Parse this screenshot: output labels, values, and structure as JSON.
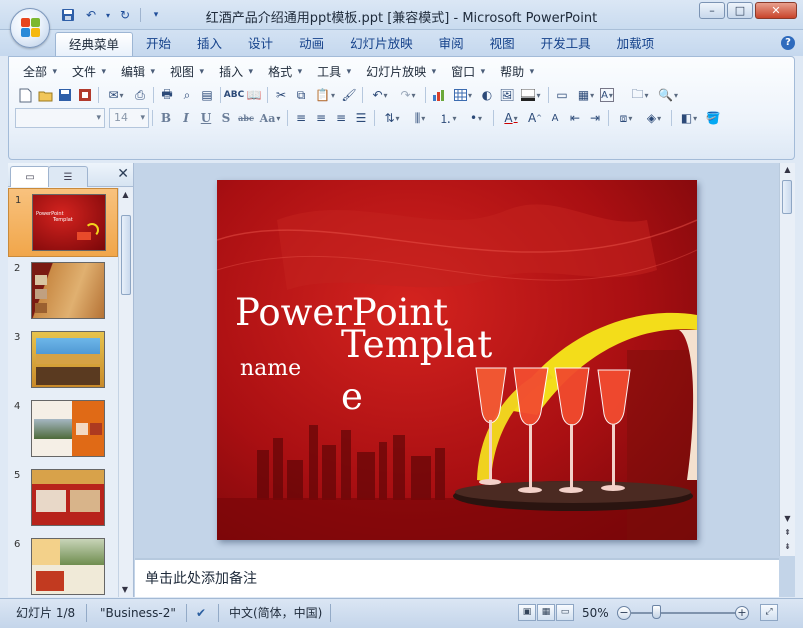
{
  "window": {
    "title": "红酒产品介绍通用ppt模板.ppt [兼容模式] - Microsoft PowerPoint",
    "minimize": "–",
    "maximize": "□",
    "close": "✕"
  },
  "quick_access": {
    "save_icon": "save-icon",
    "undo_icon": "undo-icon",
    "redo_icon": "redo-icon",
    "customize": "▾"
  },
  "tabs": [
    {
      "label": "经典菜单",
      "active": true
    },
    {
      "label": "开始"
    },
    {
      "label": "插入"
    },
    {
      "label": "设计"
    },
    {
      "label": "动画"
    },
    {
      "label": "幻灯片放映"
    },
    {
      "label": "审阅"
    },
    {
      "label": "视图"
    },
    {
      "label": "开发工具"
    },
    {
      "label": "加载项"
    }
  ],
  "menus": [
    "全部",
    "文件",
    "编辑",
    "视图",
    "插入",
    "格式",
    "工具",
    "幻灯片放映",
    "窗口",
    "帮助"
  ],
  "format": {
    "font_name": "",
    "font_size": "14",
    "bold": "B",
    "italic": "I",
    "underline": "U",
    "shadow": "S",
    "strike": "abc",
    "case": "Aa"
  },
  "slides_pane": {
    "thumbnails": [
      {
        "number": "1",
        "selected": true
      },
      {
        "number": "2"
      },
      {
        "number": "3"
      },
      {
        "number": "4"
      },
      {
        "number": "5"
      },
      {
        "number": "6"
      }
    ]
  },
  "slide": {
    "title_line1": "PowerPoint",
    "title_line2": "Templat",
    "title_line3": "e",
    "subtitle": "name"
  },
  "notes": {
    "placeholder": "单击此处添加备注"
  },
  "status": {
    "slide_info": "幻灯片 1/8",
    "theme": "\"Business-2\"",
    "language": "中文(简体，中国)",
    "zoom": "50%",
    "zoom_level": 0.5
  },
  "colors": {
    "accent_blue": "#15428b",
    "selection": "#f1a64a",
    "slide_red": "#a90f12"
  }
}
